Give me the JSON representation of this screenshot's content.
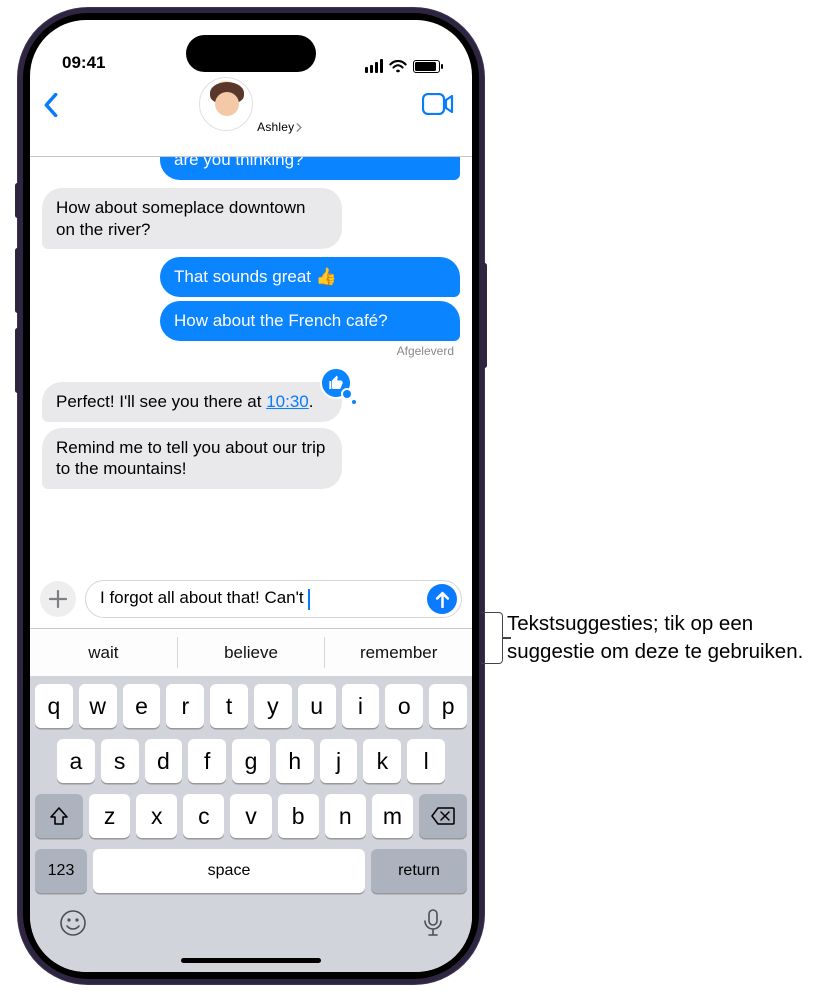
{
  "status": {
    "time": "09:41"
  },
  "header": {
    "contact_name": "Ashley"
  },
  "messages": {
    "m0": "are you thinking?",
    "m1": "How about someplace downtown on the river?",
    "m2": "That sounds great 👍",
    "m3": "How about the French café?",
    "delivered": "Afgeleverd",
    "m4_pre": "Perfect! I'll see you there at ",
    "m4_time": "10:30",
    "m4_post": ".",
    "m5": "Remind me to tell you about our trip to the mountains!"
  },
  "compose": {
    "draft": "I forgot all about that! Can't "
  },
  "suggestions": [
    "wait",
    "believe",
    "remember"
  ],
  "keyboard": {
    "row1": [
      "q",
      "w",
      "e",
      "r",
      "t",
      "y",
      "u",
      "i",
      "o",
      "p"
    ],
    "row2": [
      "a",
      "s",
      "d",
      "f",
      "g",
      "h",
      "j",
      "k",
      "l"
    ],
    "row3": [
      "z",
      "x",
      "c",
      "v",
      "b",
      "n",
      "m"
    ],
    "numkey": "123",
    "space": "space",
    "return": "return"
  },
  "callout": {
    "text": "Tekstsuggesties; tik op een suggestie om deze te gebruiken."
  }
}
